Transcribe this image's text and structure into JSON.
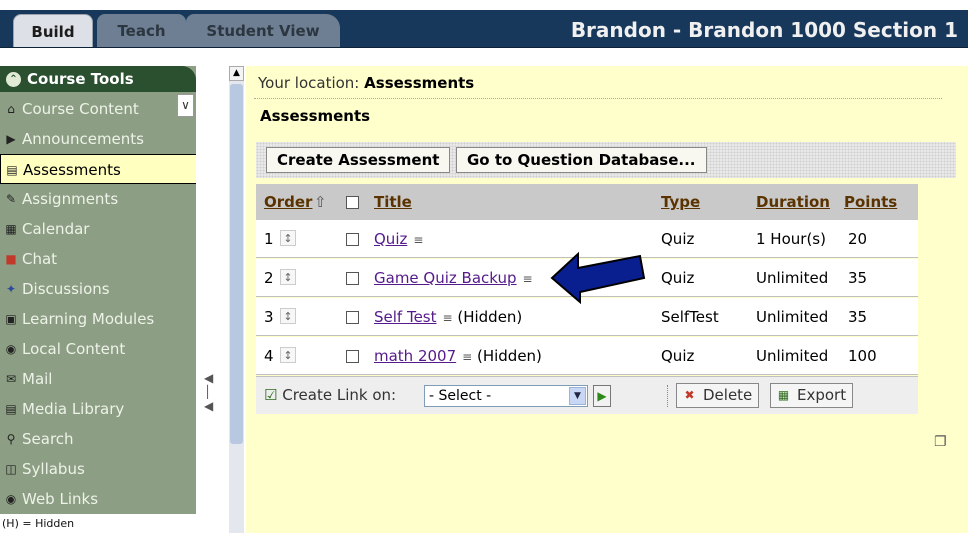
{
  "tabs": [
    {
      "label": "Build"
    },
    {
      "label": "Teach"
    },
    {
      "label": "Student View"
    }
  ],
  "course_title": "Brandon - Brandon 1000 Section 1",
  "sidebar": {
    "header": "Course Tools",
    "items": [
      {
        "label": "Course Content",
        "icon": "home-icon"
      },
      {
        "label": "Announcements",
        "icon": "megaphone-icon"
      },
      {
        "label": "Assessments",
        "icon": "assessment-icon"
      },
      {
        "label": "Assignments",
        "icon": "assignment-icon"
      },
      {
        "label": "Calendar",
        "icon": "calendar-icon"
      },
      {
        "label": "Chat",
        "icon": "chat-icon"
      },
      {
        "label": "Discussions",
        "icon": "discussions-icon"
      },
      {
        "label": "Learning Modules",
        "icon": "modules-icon"
      },
      {
        "label": "Local Content",
        "icon": "local-content-icon"
      },
      {
        "label": "Mail",
        "icon": "mail-icon"
      },
      {
        "label": "Media Library",
        "icon": "media-library-icon"
      },
      {
        "label": "Search",
        "icon": "search-icon"
      },
      {
        "label": "Syllabus",
        "icon": "syllabus-icon"
      },
      {
        "label": "Web Links",
        "icon": "globe-icon"
      }
    ],
    "legend": "(H) = Hidden"
  },
  "location": {
    "prefix": "Your location:",
    "value": "Assessments"
  },
  "page_title": "Assessments",
  "toolbar": {
    "create_label": "Create Assessment",
    "database_label": "Go to Question Database..."
  },
  "table": {
    "headers": {
      "order": "Order",
      "title": "Title",
      "type": "Type",
      "duration": "Duration",
      "points": "Points"
    },
    "rows": [
      {
        "order": "1",
        "title": "Quiz",
        "hidden": "",
        "type": "Quiz",
        "duration": "1 Hour(s)",
        "points": "20"
      },
      {
        "order": "2",
        "title": "Game Quiz Backup",
        "hidden": "",
        "type": "Quiz",
        "duration": "Unlimited",
        "points": "35"
      },
      {
        "order": "3",
        "title": "Self Test",
        "hidden": "(Hidden)",
        "type": "SelfTest",
        "duration": "Unlimited",
        "points": "35"
      },
      {
        "order": "4",
        "title": "math 2007",
        "hidden": "(Hidden)",
        "type": "Quiz",
        "duration": "Unlimited",
        "points": "100"
      }
    ]
  },
  "footer": {
    "create_link_label": "Create Link on:",
    "select_value": "- Select -",
    "delete_label": "Delete",
    "export_label": "Export"
  },
  "colors": {
    "header_band": "#17385b",
    "sidebar": "#8c9e84",
    "content_bg": "#ffffcc",
    "arrow": "#0a1f8f"
  }
}
